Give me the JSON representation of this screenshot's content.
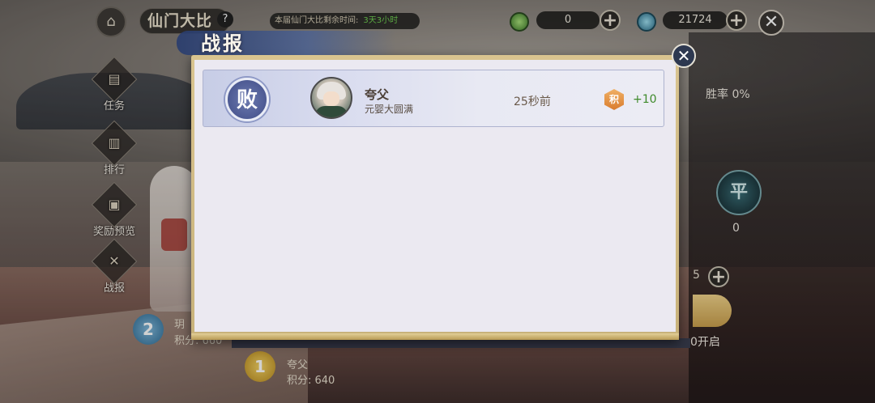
{
  "header": {
    "home_icon": "pagoda-icon",
    "title": "仙门大比",
    "help_label": "?",
    "timer_label": "本届仙门大比剩余时间:",
    "timer_value": "3天3小时",
    "resource1_value": "0",
    "resource2_value": "21724",
    "plus_label": "+",
    "close_label": "✕"
  },
  "sidebar": {
    "items": [
      {
        "label": "任务",
        "icon": "book-icon"
      },
      {
        "label": "排行",
        "icon": "banner-icon"
      },
      {
        "label": "奖励预览",
        "icon": "chest-icon"
      },
      {
        "label": "战报",
        "icon": "crossed-swords-icon"
      }
    ]
  },
  "stats": {
    "winrate_label": "胜率 0%",
    "draw_badge": "平",
    "draw_count": "0",
    "attempts": "5",
    "open_label": "0开启"
  },
  "ranking": [
    {
      "rank": "2",
      "name": "玥",
      "score_label": "积分: 660"
    },
    {
      "rank": "1",
      "name": "夸父",
      "score_label": "积分: 640"
    }
  ],
  "modal": {
    "title": "战报",
    "close_label": "✕",
    "records": [
      {
        "result": "败",
        "opponent_name": "夸父",
        "opponent_rank": "元婴大圆满",
        "time_ago": "25秒前",
        "point_icon_label": "积",
        "point_change": "+10"
      }
    ]
  },
  "colors": {
    "modal_frame": "#d9c48f",
    "modal_inner": "#ebe9f1",
    "lose_seal": "#4d5a93",
    "point_positive": "#3e8a2a"
  }
}
